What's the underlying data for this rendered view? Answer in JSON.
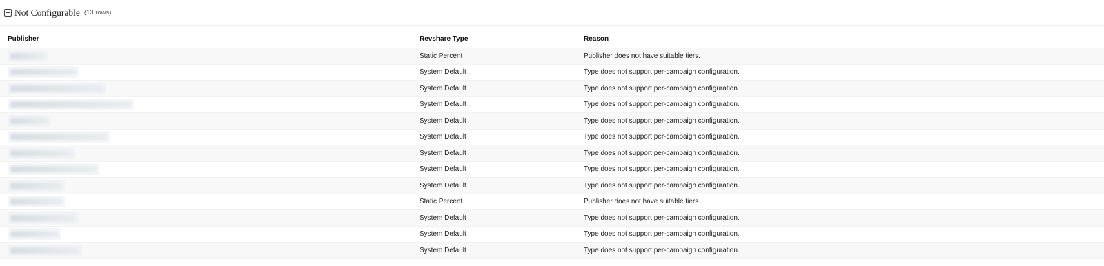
{
  "group": {
    "title": "Not Configurable",
    "count": "(13 rows)"
  },
  "table": {
    "columns": [
      "Publisher",
      "Revshare Type",
      "Reason"
    ],
    "rows": [
      {
        "publisher_redacted": true,
        "type": "Static Percent",
        "reason": "Publisher does not have suitable tiers."
      },
      {
        "publisher_redacted": true,
        "type": "System Default",
        "reason": "Type does not support per-campaign configuration."
      },
      {
        "publisher_redacted": true,
        "type": "System Default",
        "reason": "Type does not support per-campaign configuration."
      },
      {
        "publisher_redacted": true,
        "type": "System Default",
        "reason": "Type does not support per-campaign configuration."
      },
      {
        "publisher_redacted": true,
        "type": "System Default",
        "reason": "Type does not support per-campaign configuration."
      },
      {
        "publisher_redacted": true,
        "type": "System Default",
        "reason": "Type does not support per-campaign configuration."
      },
      {
        "publisher_redacted": true,
        "type": "System Default",
        "reason": "Type does not support per-campaign configuration."
      },
      {
        "publisher_redacted": true,
        "type": "System Default",
        "reason": "Type does not support per-campaign configuration."
      },
      {
        "publisher_redacted": true,
        "type": "System Default",
        "reason": "Type does not support per-campaign configuration."
      },
      {
        "publisher_redacted": true,
        "type": "Static Percent",
        "reason": "Publisher does not have suitable tiers."
      },
      {
        "publisher_redacted": true,
        "type": "System Default",
        "reason": "Type does not support per-campaign configuration."
      },
      {
        "publisher_redacted": true,
        "type": "System Default",
        "reason": "Type does not support per-campaign configuration."
      },
      {
        "publisher_redacted": true,
        "type": "System Default",
        "reason": "Type does not support per-campaign configuration."
      }
    ]
  }
}
